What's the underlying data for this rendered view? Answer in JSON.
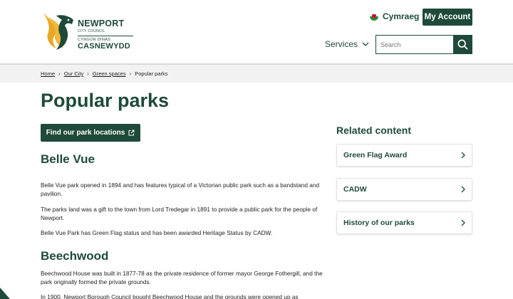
{
  "header": {
    "logo": {
      "line1": "NEWPORT",
      "line2": "CITY COUNCIL",
      "line3": "CYNGOR DINAS",
      "line4": "CASNEWYDD"
    },
    "language_label": "Cymraeg",
    "my_account_label": "My Account",
    "services_label": "Services",
    "search": {
      "placeholder": "Search"
    }
  },
  "breadcrumb": {
    "items": [
      "Home",
      "Our City",
      "Green spaces",
      "Popular parks"
    ]
  },
  "main": {
    "title": "Popular parks",
    "find_button_label": "Find our park locations",
    "sections": [
      {
        "heading": "Belle Vue",
        "paragraphs": [
          "Belle Vue park opened in 1894 and has features typical of a Victorian public park such as a bandstand and pavilion.",
          "The parks land was a gift to the town from Lord Tredegar in 1891 to provide a public park for the people of Newport.",
          "Belle Vue Park has Green Flag status and has been awarded Heritage Status by CADW."
        ]
      },
      {
        "heading": "Beechwood",
        "paragraphs": [
          "Beechwood House was built in 1877-78 as the private residence of former mayor George Fothergill, and the park originally formed the private grounds.",
          "In 1900, Newport Borough Council bought Beechwood House and the grounds were opened up as"
        ]
      }
    ]
  },
  "related": {
    "title": "Related content",
    "items": [
      "Green Flag Award",
      "CADW",
      "History of our parks"
    ]
  },
  "colors": {
    "brand_green": "#1f4a3a",
    "logo_gold": "#e8a825",
    "breadcrumb_bg": "#f2f2f2"
  }
}
